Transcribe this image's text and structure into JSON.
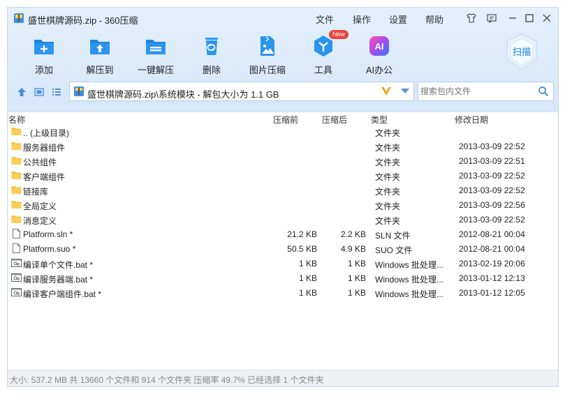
{
  "window": {
    "title": "盛世棋牌源码.zip - 360压缩",
    "menus": [
      "文件",
      "操作",
      "设置",
      "帮助"
    ]
  },
  "toolbar": {
    "tools": [
      {
        "label": "添加",
        "icon": "add-file-icon"
      },
      {
        "label": "解压到",
        "icon": "extract-to-icon"
      },
      {
        "label": "一键解压",
        "icon": "one-click-extract-icon"
      },
      {
        "label": "删除",
        "icon": "trash-icon"
      },
      {
        "label": "图片压缩",
        "icon": "image-compress-icon"
      },
      {
        "label": "工具",
        "icon": "tools-icon",
        "badge": "New"
      },
      {
        "label": "AI办公",
        "icon": "ai-icon",
        "icon_text": "AI"
      }
    ],
    "scan_label": "扫描"
  },
  "address": {
    "path": "盛世棋牌源码.zip\\系统模块 - 解包大小为 1.1 GB"
  },
  "search": {
    "placeholder": "搜索包内文件"
  },
  "columns": {
    "name": "名称",
    "compressed_before": "压缩前",
    "compressed_after": "压缩后",
    "type": "类型",
    "modified": "修改日期"
  },
  "files": [
    {
      "name": ".. (上级目录)",
      "kind": "folder",
      "orig_size": "",
      "packed_size": "",
      "type": "文件夹",
      "date": ""
    },
    {
      "name": "服务器组件",
      "kind": "folder",
      "orig_size": "",
      "packed_size": "",
      "type": "文件夹",
      "date": "2013-03-09 22:52"
    },
    {
      "name": "公共组件",
      "kind": "folder",
      "orig_size": "",
      "packed_size": "",
      "type": "文件夹",
      "date": "2013-03-09 22:51"
    },
    {
      "name": "客户端组件",
      "kind": "folder",
      "orig_size": "",
      "packed_size": "",
      "type": "文件夹",
      "date": "2013-03-09 22:52"
    },
    {
      "name": "链接库",
      "kind": "folder",
      "orig_size": "",
      "packed_size": "",
      "type": "文件夹",
      "date": "2013-03-09 22:52"
    },
    {
      "name": "全局定义",
      "kind": "folder",
      "orig_size": "",
      "packed_size": "",
      "type": "文件夹",
      "date": "2013-03-09 22:56"
    },
    {
      "name": "消息定义",
      "kind": "folder",
      "orig_size": "",
      "packed_size": "",
      "type": "文件夹",
      "date": "2013-03-09 22:52"
    },
    {
      "name": "Platform.sln *",
      "kind": "file",
      "orig_size": "21.2 KB",
      "packed_size": "2.2 KB",
      "type": "SLN 文件",
      "date": "2012-08-21 00:04"
    },
    {
      "name": "Platform.suo *",
      "kind": "file",
      "orig_size": "50.5 KB",
      "packed_size": "4.9 KB",
      "type": "SUO 文件",
      "date": "2012-08-21 00:04"
    },
    {
      "name": "编译单个文件.bat *",
      "kind": "bat",
      "orig_size": "1 KB",
      "packed_size": "1 KB",
      "type": "Windows 批处理...",
      "date": "2013-02-19 20:06"
    },
    {
      "name": "编译服务器端.bat *",
      "kind": "bat",
      "orig_size": "1 KB",
      "packed_size": "1 KB",
      "type": "Windows 批处理...",
      "date": "2013-01-12 12:13"
    },
    {
      "name": "编译客户端组件.bat *",
      "kind": "bat",
      "orig_size": "1 KB",
      "packed_size": "1 KB",
      "type": "Windows 批处理...",
      "date": "2013-01-12 12:05"
    }
  ],
  "status": {
    "text": "大小: 537.2 MB 共 13660 个文件和 914 个文件夹 压缩率 49.7% 已经选择 1 个文件夹"
  },
  "colors": {
    "accent": "#2a8ee6",
    "folder": "#f6c244",
    "header_band": "#dbeafa"
  }
}
